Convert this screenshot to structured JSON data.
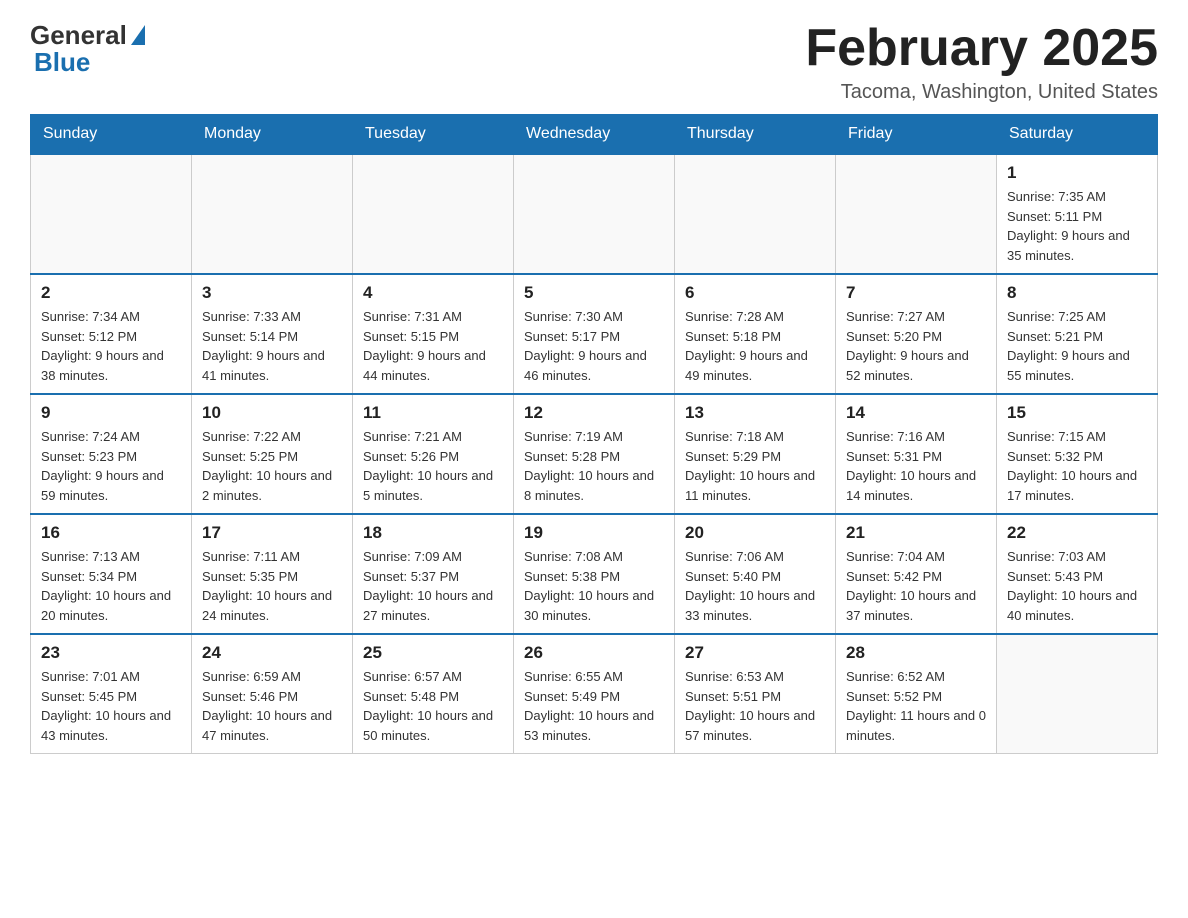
{
  "logo": {
    "general": "General",
    "blue": "Blue"
  },
  "header": {
    "title": "February 2025",
    "subtitle": "Tacoma, Washington, United States"
  },
  "weekdays": [
    "Sunday",
    "Monday",
    "Tuesday",
    "Wednesday",
    "Thursday",
    "Friday",
    "Saturday"
  ],
  "weeks": [
    [
      {
        "day": "",
        "info": ""
      },
      {
        "day": "",
        "info": ""
      },
      {
        "day": "",
        "info": ""
      },
      {
        "day": "",
        "info": ""
      },
      {
        "day": "",
        "info": ""
      },
      {
        "day": "",
        "info": ""
      },
      {
        "day": "1",
        "info": "Sunrise: 7:35 AM\nSunset: 5:11 PM\nDaylight: 9 hours and 35 minutes."
      }
    ],
    [
      {
        "day": "2",
        "info": "Sunrise: 7:34 AM\nSunset: 5:12 PM\nDaylight: 9 hours and 38 minutes."
      },
      {
        "day": "3",
        "info": "Sunrise: 7:33 AM\nSunset: 5:14 PM\nDaylight: 9 hours and 41 minutes."
      },
      {
        "day": "4",
        "info": "Sunrise: 7:31 AM\nSunset: 5:15 PM\nDaylight: 9 hours and 44 minutes."
      },
      {
        "day": "5",
        "info": "Sunrise: 7:30 AM\nSunset: 5:17 PM\nDaylight: 9 hours and 46 minutes."
      },
      {
        "day": "6",
        "info": "Sunrise: 7:28 AM\nSunset: 5:18 PM\nDaylight: 9 hours and 49 minutes."
      },
      {
        "day": "7",
        "info": "Sunrise: 7:27 AM\nSunset: 5:20 PM\nDaylight: 9 hours and 52 minutes."
      },
      {
        "day": "8",
        "info": "Sunrise: 7:25 AM\nSunset: 5:21 PM\nDaylight: 9 hours and 55 minutes."
      }
    ],
    [
      {
        "day": "9",
        "info": "Sunrise: 7:24 AM\nSunset: 5:23 PM\nDaylight: 9 hours and 59 minutes."
      },
      {
        "day": "10",
        "info": "Sunrise: 7:22 AM\nSunset: 5:25 PM\nDaylight: 10 hours and 2 minutes."
      },
      {
        "day": "11",
        "info": "Sunrise: 7:21 AM\nSunset: 5:26 PM\nDaylight: 10 hours and 5 minutes."
      },
      {
        "day": "12",
        "info": "Sunrise: 7:19 AM\nSunset: 5:28 PM\nDaylight: 10 hours and 8 minutes."
      },
      {
        "day": "13",
        "info": "Sunrise: 7:18 AM\nSunset: 5:29 PM\nDaylight: 10 hours and 11 minutes."
      },
      {
        "day": "14",
        "info": "Sunrise: 7:16 AM\nSunset: 5:31 PM\nDaylight: 10 hours and 14 minutes."
      },
      {
        "day": "15",
        "info": "Sunrise: 7:15 AM\nSunset: 5:32 PM\nDaylight: 10 hours and 17 minutes."
      }
    ],
    [
      {
        "day": "16",
        "info": "Sunrise: 7:13 AM\nSunset: 5:34 PM\nDaylight: 10 hours and 20 minutes."
      },
      {
        "day": "17",
        "info": "Sunrise: 7:11 AM\nSunset: 5:35 PM\nDaylight: 10 hours and 24 minutes."
      },
      {
        "day": "18",
        "info": "Sunrise: 7:09 AM\nSunset: 5:37 PM\nDaylight: 10 hours and 27 minutes."
      },
      {
        "day": "19",
        "info": "Sunrise: 7:08 AM\nSunset: 5:38 PM\nDaylight: 10 hours and 30 minutes."
      },
      {
        "day": "20",
        "info": "Sunrise: 7:06 AM\nSunset: 5:40 PM\nDaylight: 10 hours and 33 minutes."
      },
      {
        "day": "21",
        "info": "Sunrise: 7:04 AM\nSunset: 5:42 PM\nDaylight: 10 hours and 37 minutes."
      },
      {
        "day": "22",
        "info": "Sunrise: 7:03 AM\nSunset: 5:43 PM\nDaylight: 10 hours and 40 minutes."
      }
    ],
    [
      {
        "day": "23",
        "info": "Sunrise: 7:01 AM\nSunset: 5:45 PM\nDaylight: 10 hours and 43 minutes."
      },
      {
        "day": "24",
        "info": "Sunrise: 6:59 AM\nSunset: 5:46 PM\nDaylight: 10 hours and 47 minutes."
      },
      {
        "day": "25",
        "info": "Sunrise: 6:57 AM\nSunset: 5:48 PM\nDaylight: 10 hours and 50 minutes."
      },
      {
        "day": "26",
        "info": "Sunrise: 6:55 AM\nSunset: 5:49 PM\nDaylight: 10 hours and 53 minutes."
      },
      {
        "day": "27",
        "info": "Sunrise: 6:53 AM\nSunset: 5:51 PM\nDaylight: 10 hours and 57 minutes."
      },
      {
        "day": "28",
        "info": "Sunrise: 6:52 AM\nSunset: 5:52 PM\nDaylight: 11 hours and 0 minutes."
      },
      {
        "day": "",
        "info": ""
      }
    ]
  ]
}
